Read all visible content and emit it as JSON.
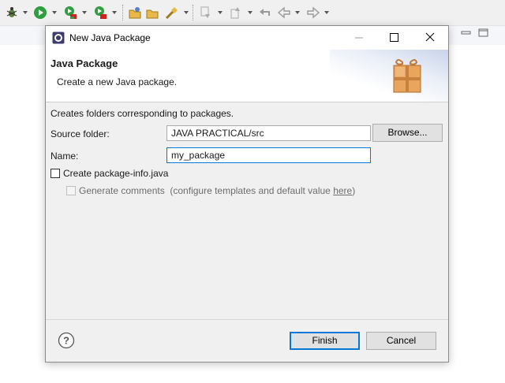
{
  "dialog": {
    "title": "New Java Package",
    "heading": "Java Package",
    "subheading": "Create a new Java package.",
    "description": "Creates folders corresponding to packages.",
    "source_folder": {
      "label": "Source folder:",
      "value": "JAVA PRACTICAL/src",
      "browse_label": "Browse..."
    },
    "name": {
      "label": "Name:",
      "value": "my_package"
    },
    "create_package_info": {
      "label": "Create package-info.java",
      "checked": false
    },
    "generate_comments": {
      "label": "Generate comments",
      "checked": false,
      "enabled": false,
      "hint_prefix": "(configure templates and default value ",
      "hint_link": "here",
      "hint_suffix": ")"
    },
    "buttons": {
      "finish": "Finish",
      "cancel": "Cancel"
    }
  },
  "toolbar": {
    "icons": [
      "debug-icon",
      "run-icon",
      "coverage-icon",
      "external-tools-icon",
      "new-java-project-icon",
      "open-type-icon",
      "search-icon",
      "next-annotation-icon",
      "previous-annotation-icon",
      "last-edit-location-icon",
      "back-icon",
      "forward-icon"
    ]
  },
  "colors": {
    "accent": "#0078d7",
    "dialog_bg": "#f0f0f0",
    "run_green": "#2e9e3e",
    "debug_red": "#cc2222"
  }
}
